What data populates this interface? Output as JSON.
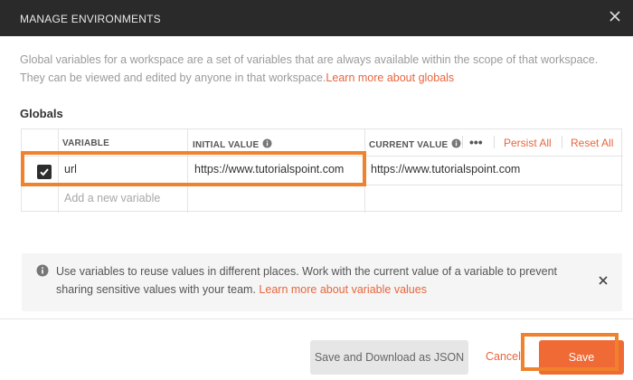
{
  "dialog": {
    "title": "MANAGE ENVIRONMENTS"
  },
  "intro": {
    "text": "Global variables for a workspace are a set of variables that are always available within the scope of that workspace. They can be viewed and edited by anyone in that workspace.",
    "link": "Learn more about globals"
  },
  "section": {
    "title": "Globals"
  },
  "table": {
    "headers": {
      "variable": "VARIABLE",
      "initial_value": "INITIAL VALUE",
      "current_value": "CURRENT VALUE"
    },
    "more_label": "•••",
    "persist_all": "Persist All",
    "reset_all": "Reset All",
    "rows": [
      {
        "checked": true,
        "variable": "url",
        "initial_value": "https://www.tutorialspoint.com",
        "current_value": "https://www.tutorialspoint.com"
      }
    ],
    "add_placeholder": "Add a new variable"
  },
  "info": {
    "text": "Use variables to reuse values in different places. Work with the current value of a variable to prevent sharing sensitive values with your team.",
    "link": "Learn more about variable values"
  },
  "footer": {
    "download_label": "Save and Download as JSON",
    "cancel_label": "Cancel",
    "save_label": "Save"
  },
  "colors": {
    "accent": "#ef6a35",
    "highlight": "#f0822d",
    "titlebar": "#2a2a2a"
  },
  "icons": {
    "close": "close-icon",
    "info": "info-icon",
    "check": "check-icon"
  }
}
